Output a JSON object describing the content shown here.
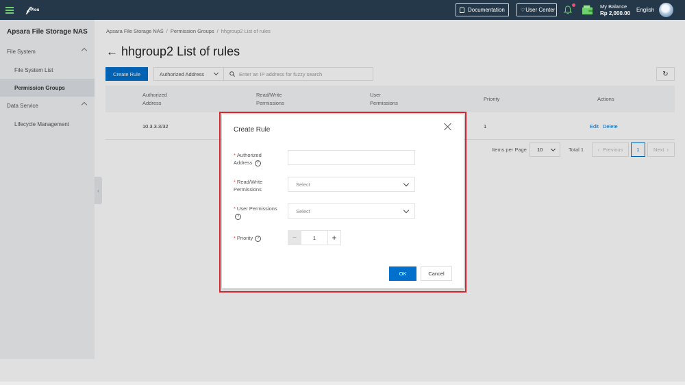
{
  "topbar": {
    "logo_text": "Plou",
    "documentation_label": "Documentation",
    "user_center_label": "User Center",
    "balance_label": "My Balance",
    "balance_value": "Rp 2,000.00",
    "language": "English"
  },
  "sidebar": {
    "title": "Apsara File Storage NAS",
    "items": [
      {
        "label": "File System"
      },
      {
        "label": "File System List"
      },
      {
        "label": "Permission Groups"
      },
      {
        "label": "Data Service"
      },
      {
        "label": "Lifecycle Management"
      }
    ]
  },
  "breadcrumb": [
    "Apsara File Storage NAS",
    "Permission Groups",
    "hhgroup2 List of rules"
  ],
  "page": {
    "title": "hhgroup2 List of rules"
  },
  "toolbar": {
    "create_label": "Create Rule",
    "filter_label": "Authorized Address",
    "search_placeholder": "Enter an IP address for fuzzy search"
  },
  "table": {
    "columns": [
      [
        "Authorized",
        "Address"
      ],
      [
        "Read/Write",
        "Permissions"
      ],
      [
        "User",
        "Permissions"
      ],
      [
        "Priority",
        ""
      ],
      [
        "Actions",
        ""
      ]
    ],
    "rows": [
      {
        "address": "10.3.3.3/32",
        "priority": "1",
        "edit": "Edit",
        "delete": "Delete"
      }
    ]
  },
  "pagination": {
    "items_per_page_label": "Items per Page",
    "page_size": "10",
    "total_label": "Total 1",
    "previous_label": "Previous",
    "current_page": "1",
    "next_label": "Next"
  },
  "dialog": {
    "title": "Create Rule",
    "fields": {
      "address_label_line1": "Authorized",
      "address_label_line2": "Address",
      "rw_label_line1": "Read/Write",
      "rw_label_line2": "Permissions",
      "rw_placeholder": "Select",
      "user_label": "User Permissions",
      "user_placeholder": "Select",
      "priority_label": "Priority",
      "priority_value": "1"
    },
    "ok_label": "OK",
    "cancel_label": "Cancel"
  },
  "colors": {
    "primary": "#0070cc",
    "topbar_bg": "#24384a",
    "highlight_frame": "#d9262e"
  }
}
